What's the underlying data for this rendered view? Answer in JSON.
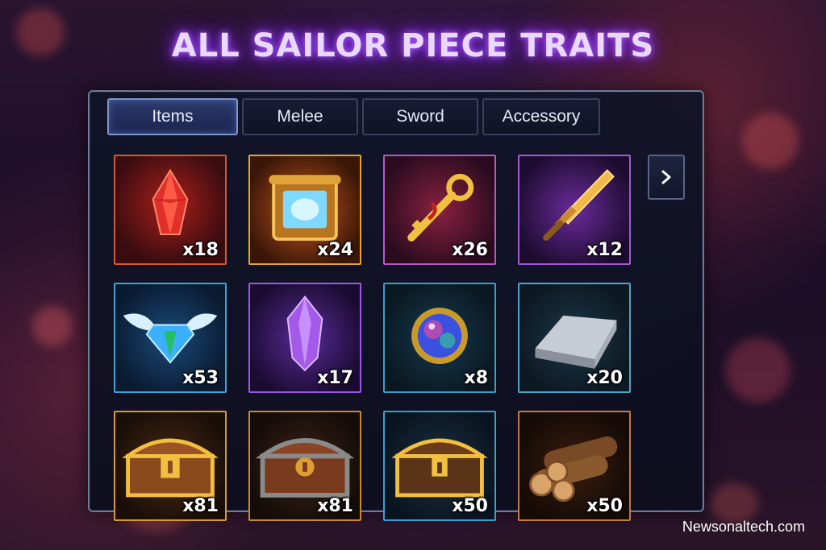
{
  "title": "ALL SAILOR PIECE TRAITS",
  "tabs": [
    "Items",
    "Melee",
    "Sword",
    "Accessory"
  ],
  "active_tab": "Items",
  "items": [
    {
      "icon": "red-crystal-icon",
      "quantity": "x18",
      "frame": "#d35a2a"
    },
    {
      "icon": "scroll-icon",
      "quantity": "x24",
      "frame": "#e0a43a"
    },
    {
      "icon": "golden-key-icon",
      "quantity": "x26",
      "frame": "#b65abf"
    },
    {
      "icon": "golden-sword-icon",
      "quantity": "x12",
      "frame": "#a15ad6"
    },
    {
      "icon": "winged-gem-icon",
      "quantity": "x53",
      "frame": "#3aa6d6"
    },
    {
      "icon": "purple-crystal-icon",
      "quantity": "x17",
      "frame": "#9a5ae0"
    },
    {
      "icon": "orb-icon",
      "quantity": "x8",
      "frame": "#3a9fc4"
    },
    {
      "icon": "silver-ingot-icon",
      "quantity": "x20",
      "frame": "#4aa6cc"
    },
    {
      "icon": "gold-chest-icon",
      "quantity": "x81",
      "frame": "#d49a34"
    },
    {
      "icon": "iron-chest-icon",
      "quantity": "x81",
      "frame": "#c88a3a"
    },
    {
      "icon": "blue-chest-icon",
      "quantity": "x50",
      "frame": "#3a9fcc"
    },
    {
      "icon": "wood-logs-icon",
      "quantity": "x50",
      "frame": "#c87a3a"
    }
  ],
  "next_page_icon": "chevron-right-icon",
  "watermark": "Newsonaltech.com"
}
